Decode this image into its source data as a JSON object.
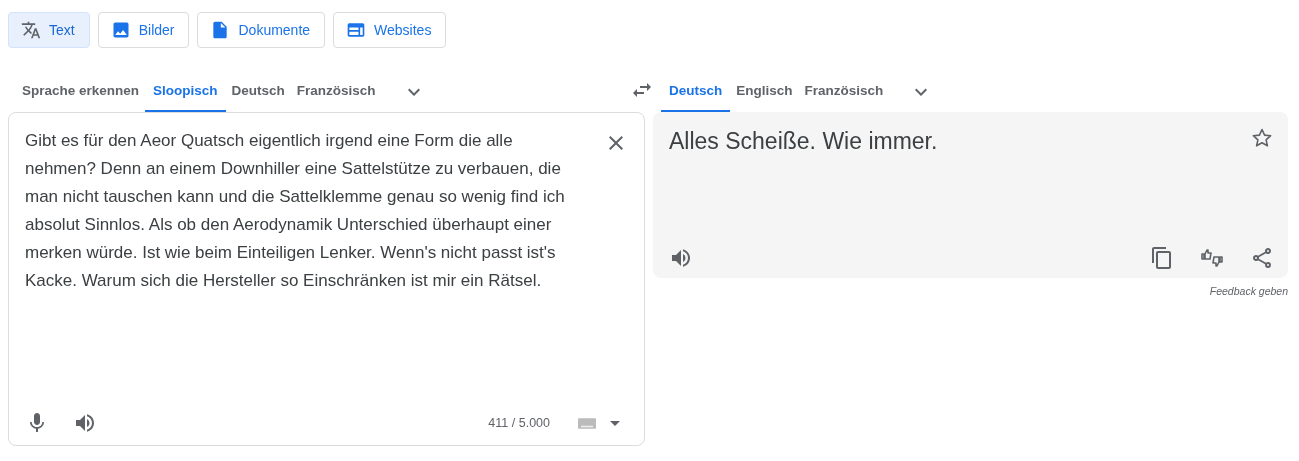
{
  "modes": [
    {
      "label": "Text",
      "kind": "translate",
      "selected": true
    },
    {
      "label": "Bilder",
      "kind": "image",
      "selected": false
    },
    {
      "label": "Dokumente",
      "kind": "document",
      "selected": false
    },
    {
      "label": "Websites",
      "kind": "web",
      "selected": false
    }
  ],
  "source_languages": [
    {
      "label": "Sprache erkennen",
      "selected": false
    },
    {
      "label": "Sloopisch",
      "selected": true
    },
    {
      "label": "Deutsch",
      "selected": false
    },
    {
      "label": "Französisch",
      "selected": false
    }
  ],
  "target_languages": [
    {
      "label": "Deutsch",
      "selected": true
    },
    {
      "label": "Englisch",
      "selected": false
    },
    {
      "label": "Französisch",
      "selected": false
    }
  ],
  "source": {
    "text": "Gibt es für den Aeor Quatsch eigentlich irgend eine Form die alle nehmen? Denn an einem Downhiller eine Sattelstütze zu verbauen, die man nicht tauschen kann und die Sattelklemme genau so wenig find ich absolut Sinnlos. Als ob den Aerodynamik Unterschied überhaupt einer merken würde. Ist wie beim Einteiligen Lenker. Wenn's nicht passt ist's Kacke. Warum sich die Hersteller so Einschränken ist mir ein Rätsel.",
    "char_count": "411 / 5.000"
  },
  "translation": {
    "text": "Alles Scheiße. Wie immer.",
    "saved": false
  },
  "feedback": "Feedback geben"
}
